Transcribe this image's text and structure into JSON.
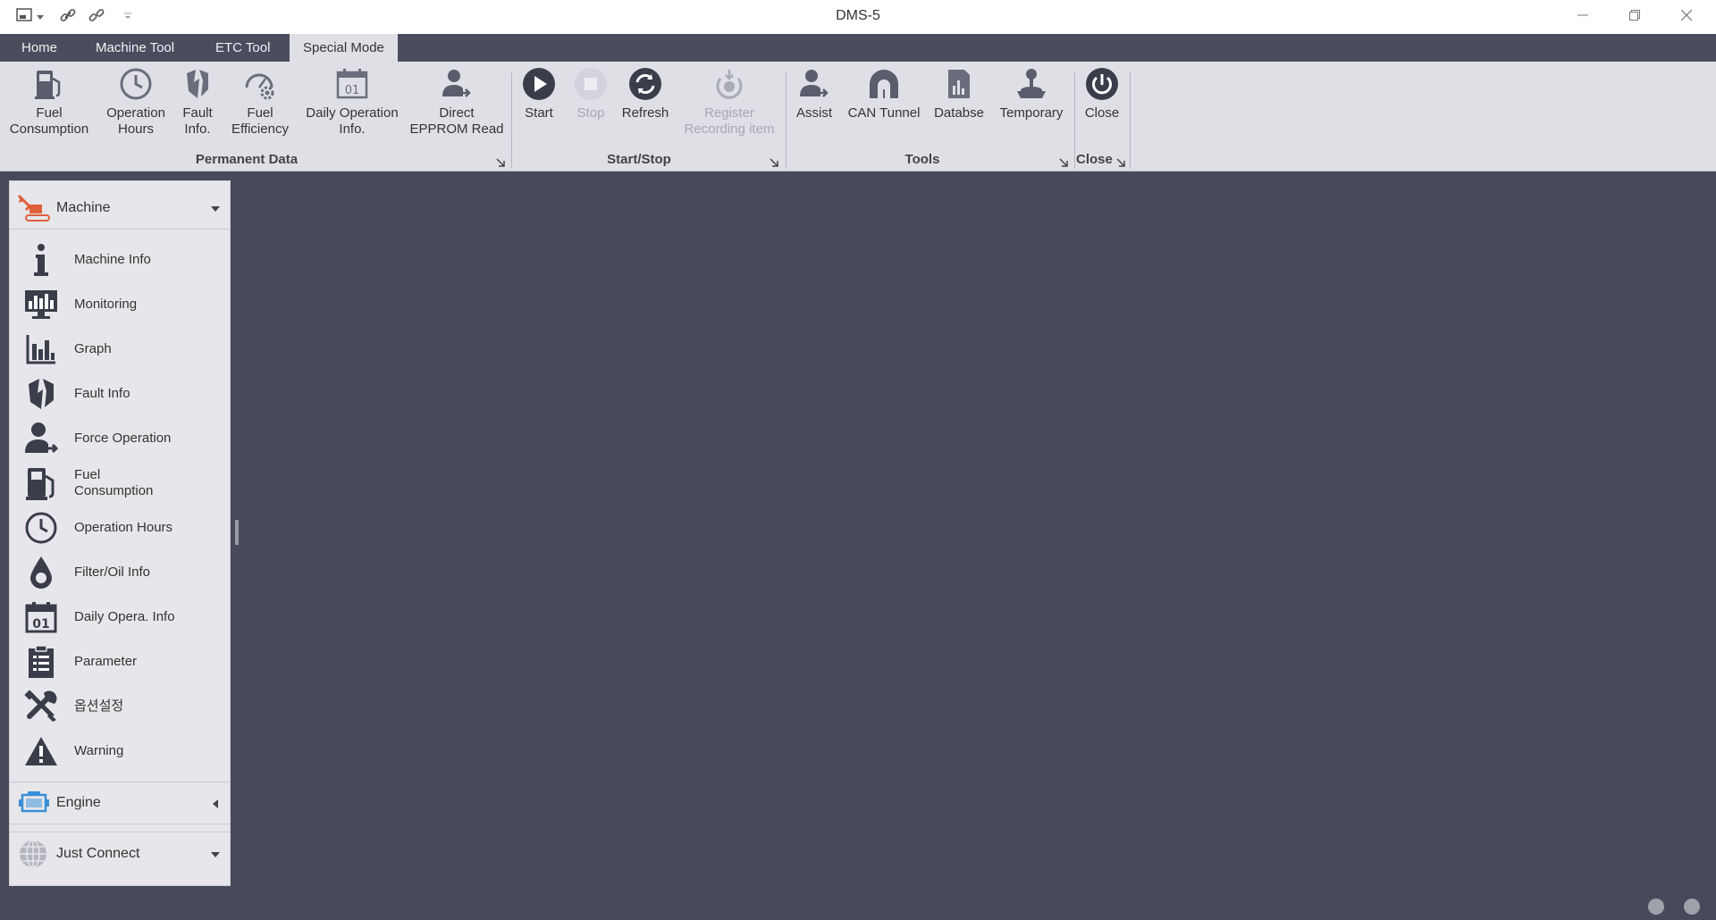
{
  "window": {
    "title": "DMS-5",
    "quick_access_icons": [
      "window-icon",
      "chevron-down-icon",
      "link-icon",
      "link-icon",
      "customize-icon"
    ]
  },
  "tabs": [
    {
      "label": "Home",
      "active": false
    },
    {
      "label": "Machine Tool",
      "active": false
    },
    {
      "label": "ETC Tool",
      "active": false
    },
    {
      "label": "Special Mode",
      "active": true
    }
  ],
  "ribbon": {
    "groups": [
      {
        "label": "Permanent Data"
      },
      {
        "label": "Start/Stop"
      },
      {
        "label": "Tools"
      },
      {
        "label": "Close"
      }
    ],
    "buttons": [
      {
        "line1": "Fuel",
        "line2": "Consumption",
        "enabled": true
      },
      {
        "line1": "Operation",
        "line2": "Hours",
        "enabled": true
      },
      {
        "line1": "Fault",
        "line2": "Info.",
        "enabled": true
      },
      {
        "line1": "Fuel",
        "line2": "Efficiency",
        "enabled": true
      },
      {
        "line1": "Daily Operation",
        "line2": "Info.",
        "enabled": true
      },
      {
        "line1": "Direct",
        "line2": "EPPROM Read",
        "enabled": true
      },
      {
        "line1": "Start",
        "line2": "",
        "enabled": true
      },
      {
        "line1": "Stop",
        "line2": "",
        "enabled": false
      },
      {
        "line1": "Refresh",
        "line2": "",
        "enabled": true
      },
      {
        "line1": "Register",
        "line2": "Recording item",
        "enabled": false
      },
      {
        "line1": "Assist",
        "line2": "",
        "enabled": true
      },
      {
        "line1": "CAN Tunnel",
        "line2": "",
        "enabled": true
      },
      {
        "line1": "Databse",
        "line2": "",
        "enabled": true
      },
      {
        "line1": "Temporary",
        "line2": "",
        "enabled": true
      },
      {
        "line1": "Close",
        "line2": "",
        "enabled": true
      }
    ]
  },
  "sidebar": {
    "sections": [
      {
        "label": "Machine",
        "expanded": true
      },
      {
        "label": "Engine",
        "expanded": false
      },
      {
        "label": "Just Connect",
        "expanded": true
      }
    ],
    "items": [
      {
        "label": "Machine Info",
        "line2": ""
      },
      {
        "label": "Monitoring",
        "line2": ""
      },
      {
        "label": "Graph",
        "line2": ""
      },
      {
        "label": "Fault Info",
        "line2": ""
      },
      {
        "label": "Force Operation",
        "line2": ""
      },
      {
        "label": "Fuel",
        "line2": "Consumption"
      },
      {
        "label": "Operation Hours",
        "line2": ""
      },
      {
        "label": "Filter/Oil Info",
        "line2": ""
      },
      {
        "label": "Daily Opera. Info",
        "line2": ""
      },
      {
        "label": "Parameter",
        "line2": ""
      },
      {
        "label": "옵션설정",
        "line2": ""
      },
      {
        "label": "Warning",
        "line2": ""
      }
    ]
  },
  "colors": {
    "workspace": "#474a5a",
    "ribbon": "#dfe0e6",
    "sidebar": "#e7e7eb",
    "icon_dark": "#3a3d4a",
    "machine_accent": "#e0603a",
    "engine_accent": "#3a8fd8"
  }
}
